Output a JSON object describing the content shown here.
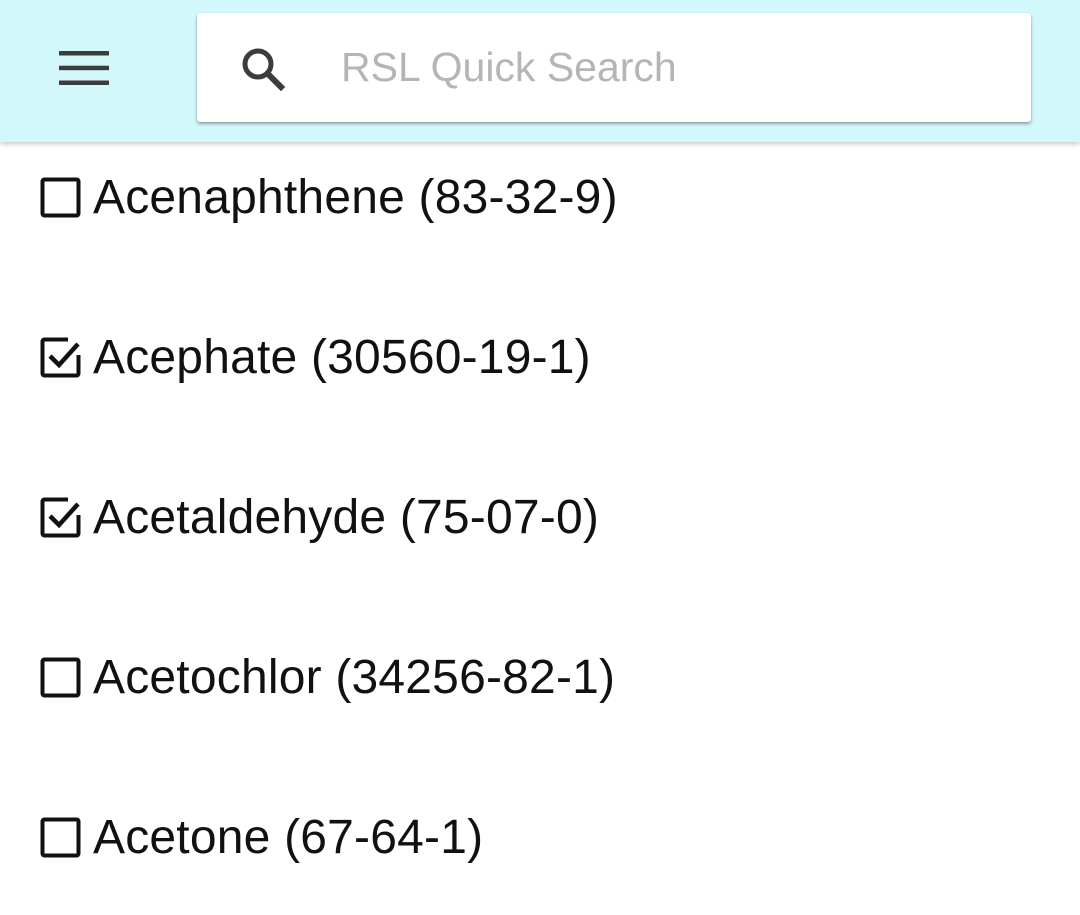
{
  "header": {
    "menu_icon": "hamburger-menu-icon",
    "background_color": "#d3f8fc"
  },
  "search": {
    "icon": "search-icon",
    "placeholder": "RSL Quick Search",
    "value": ""
  },
  "items": [
    {
      "label": "Acenaphthene (83-32-9)",
      "checked": false
    },
    {
      "label": "Acephate (30560-19-1)",
      "checked": true
    },
    {
      "label": "Acetaldehyde (75-07-0)",
      "checked": true
    },
    {
      "label": "Acetochlor (34256-82-1)",
      "checked": false
    },
    {
      "label": "Acetone (67-64-1)",
      "checked": false
    }
  ]
}
